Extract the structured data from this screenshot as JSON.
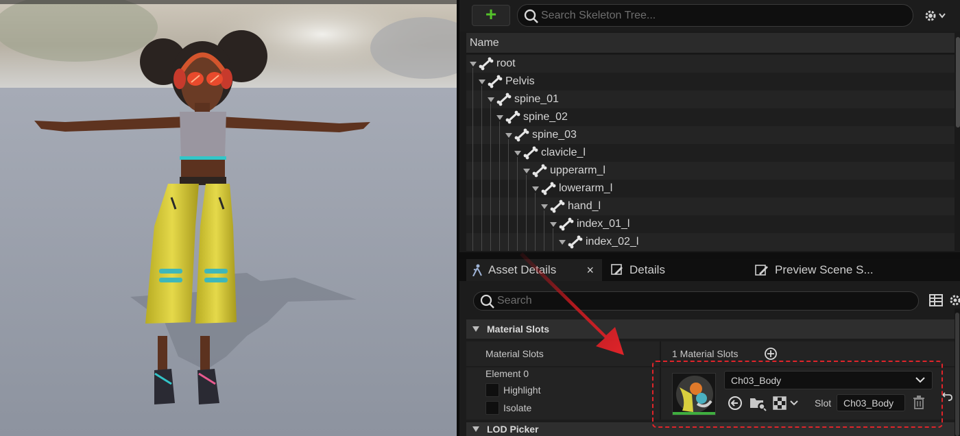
{
  "skeleton_tree": {
    "search_placeholder": "Search Skeleton Tree...",
    "add_label": "+",
    "column_header": "Name",
    "bones": [
      {
        "name": "root",
        "depth": 0
      },
      {
        "name": "Pelvis",
        "depth": 1
      },
      {
        "name": "spine_01",
        "depth": 2
      },
      {
        "name": "spine_02",
        "depth": 3
      },
      {
        "name": "spine_03",
        "depth": 4
      },
      {
        "name": "clavicle_l",
        "depth": 5
      },
      {
        "name": "upperarm_l",
        "depth": 6
      },
      {
        "name": "lowerarm_l",
        "depth": 7
      },
      {
        "name": "hand_l",
        "depth": 8
      },
      {
        "name": "index_01_l",
        "depth": 9
      },
      {
        "name": "index_02_l",
        "depth": 10
      }
    ]
  },
  "tabs": [
    {
      "label": "Asset Details",
      "icon": "asset-details-icon",
      "active": true,
      "close": "×"
    },
    {
      "label": "Details",
      "icon": "details-pencil-icon",
      "active": false
    },
    {
      "label": "Preview Scene S...",
      "icon": "preview-scene-icon",
      "active": false
    }
  ],
  "details": {
    "search_placeholder": "Search",
    "section_material_slots": "Material Slots",
    "material_slots_label": "Material Slots",
    "material_slots_count": "1 Material Slots",
    "element_label": "Element 0",
    "highlight_label": "Highlight",
    "isolate_label": "Isolate",
    "material_name": "Ch03_Body",
    "slot_label": "Slot",
    "slot_value": "Ch03_Body",
    "section_lod_picker": "LOD Picker"
  },
  "colors": {
    "accent_green": "#54c22a",
    "highlight_red": "#e0242a",
    "panel_bg": "#1c1c1c"
  }
}
